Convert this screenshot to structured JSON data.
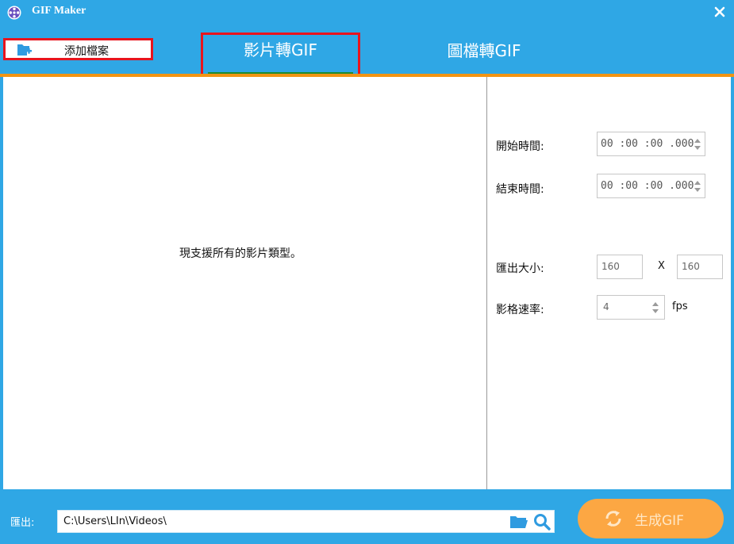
{
  "window": {
    "title": "GIF Maker",
    "close_icon": "close-icon",
    "app_icon": "film-reel-icon"
  },
  "toolbar": {
    "add_file_label": "添加檔案",
    "add_file_icon": "add-folder-icon"
  },
  "tabs": [
    {
      "label": "影片轉GIF",
      "selected": true
    },
    {
      "label": "圖檔轉GIF",
      "selected": false
    }
  ],
  "preview": {
    "message": "現支援所有的影片類型。"
  },
  "settings": {
    "start_time_label": "開始時間:",
    "start_time_value": "00 :00 :00 .000",
    "end_time_label": "結束時間:",
    "end_time_value": "00 :00 :00 .000",
    "output_size_label": "匯出大小:",
    "width_value": "160",
    "size_separator": "X",
    "height_value": "160",
    "frame_rate_label": "影格速率:",
    "frame_rate_value": "4",
    "frame_rate_unit": "fps"
  },
  "bottom": {
    "export_label": "匯出:",
    "path_value": "C:\\Users\\LIn\\Videos\\",
    "generate_label": "生成GIF"
  },
  "colors": {
    "accent_blue": "#2fa7e5",
    "orange": "#f29413",
    "button_orange": "#fca743",
    "highlight_red": "#e8141d",
    "tab_underline": "#1f8a2e"
  }
}
